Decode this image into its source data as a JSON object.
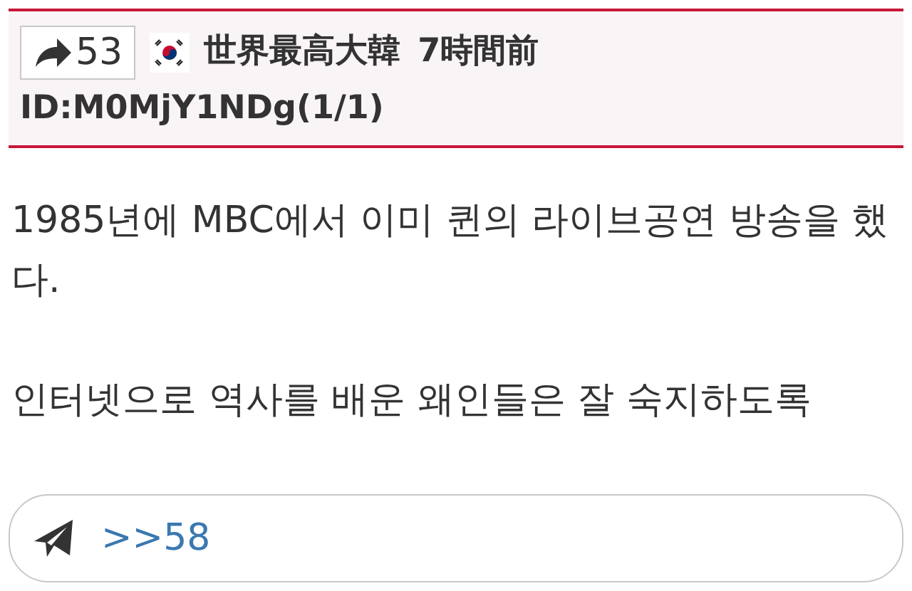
{
  "post": {
    "share_count": "53",
    "author": "世界最高大韓",
    "time": "7時間前",
    "id": "ID:M0MjY1NDg(1/1)"
  },
  "body": [
    "1985년에 MBC에서 이미 퀸의 라이브공연 방송을 했다.",
    "인터넷으로 역사를 배운 왜인들은 잘 숙지하도록"
  ],
  "reply": {
    "value": ">>58"
  }
}
